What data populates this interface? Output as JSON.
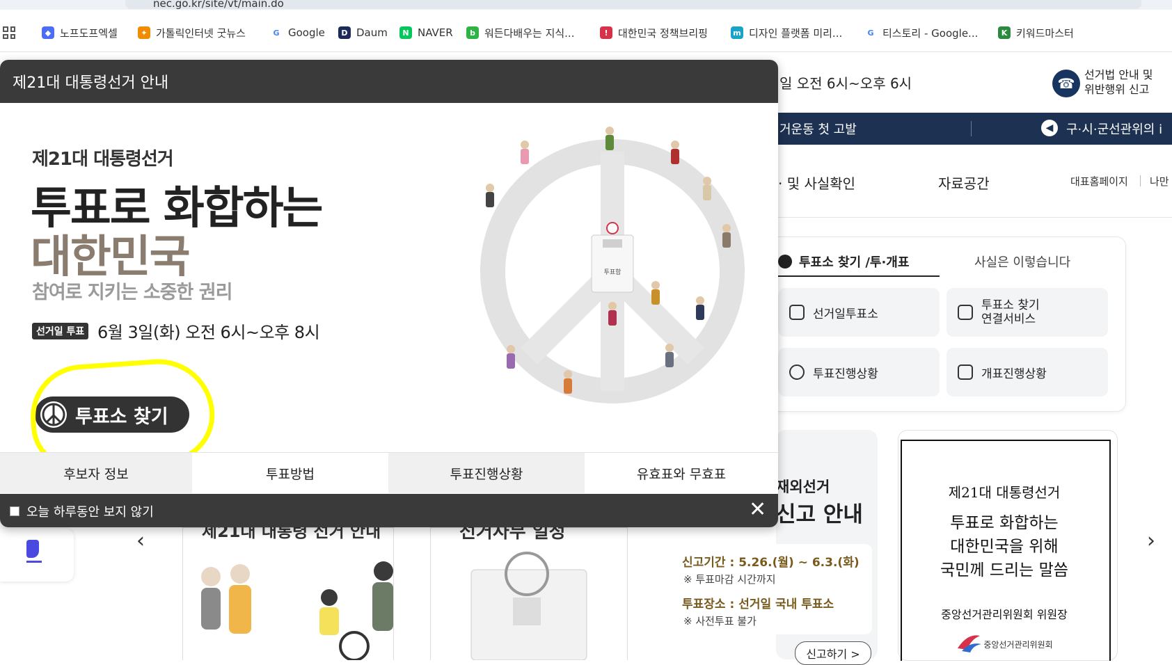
{
  "browser": {
    "address": "nec.go.kr/site/vt/main.do",
    "bookmarks": [
      {
        "label": "노프도프엑셀",
        "color": "#4c6ef5",
        "glyph": "◆"
      },
      {
        "label": "가톨릭인터넷 굿뉴스",
        "color": "#f08c00",
        "glyph": "✦"
      },
      {
        "label": "Google",
        "color": "#4285f4",
        "glyph": "G"
      },
      {
        "label": "Daum",
        "color": "#1c2a5a",
        "glyph": "D"
      },
      {
        "label": "NAVER",
        "color": "#03c75a",
        "glyph": "N"
      },
      {
        "label": "워든다배우는 지식...",
        "color": "#2fb344",
        "glyph": "b"
      },
      {
        "label": "대한민국 정책브리핑",
        "color": "#d6334a",
        "glyph": "!"
      },
      {
        "label": "디자인 플랫폼 미리...",
        "color": "#1aa3c8",
        "glyph": "m"
      },
      {
        "label": "티스토리 - Google...",
        "color": "#4285f4",
        "glyph": "G"
      },
      {
        "label": "키워드마스터",
        "color": "#2b8a3e",
        "glyph": "K"
      }
    ]
  },
  "site": {
    "vote_time": "일 오전 6시~오후 6시",
    "report_label": "선거법 안내 및 위반행위 신고",
    "notice": "거운동 첫 고발",
    "notice2": "구·시·군선관위의 i",
    "nav": [
      "· 및 사실확인",
      "자료공간"
    ],
    "util_links": [
      "대표홈페이지",
      "나만"
    ],
    "panel": {
      "tab_active": "투표소 찾기 /투·개표",
      "tab_inactive": "사실은 이렇습니다",
      "services": [
        "선거일투표소",
        "투표소 찾기 연결서비스",
        "투표진행상황",
        "개표진행상황"
      ]
    },
    "abroad": {
      "title": "재외선거",
      "big": "신고 안내",
      "period_label": "신고기간 : 5.26.(월) ~ 6.3.(화)",
      "period_note": "※ 투표마감 시간까지",
      "place_label": "투표장소 : 선거일 국내 투표소",
      "place_note": "※ 사전투표 불가",
      "button": "신고하기 >"
    },
    "letter": {
      "line1": "제21대 대통령선거",
      "line2": "투표로 화합하는",
      "line3": "대한민국을 위해",
      "line4": "국민께 드리는 말씀",
      "sign": "중앙선거관리위원회 위원장",
      "org": "중앙선거관리위원회"
    },
    "mini_titles": [
      "제21대 대통령 선거 안내",
      "선거사무 일정"
    ]
  },
  "popup": {
    "title": "제21대 대통령선거 안내",
    "hero": {
      "sub": "제21대 대통령선거",
      "line1": "투표로 화합하는",
      "line2": "대한민국",
      "line3": "참여로 지키는 소중한 권리",
      "day_badge": "선거일 투표",
      "day_text": "6월 3일(화) 오전 6시~오후 8시",
      "find_button": "투표소 찾기",
      "ballot_box_label": "투표함"
    },
    "tabs": [
      "후보자 정보",
      "투표방법",
      "투표진행상황",
      "유효표와 무효표"
    ],
    "dont_show": "오늘 하루동안 보지 않기"
  },
  "colors": {
    "popup_dark": "#3a3a3a",
    "site_navy": "#1d3152",
    "highlight": "#ffff00",
    "hero_brown": "#8a7d70"
  }
}
